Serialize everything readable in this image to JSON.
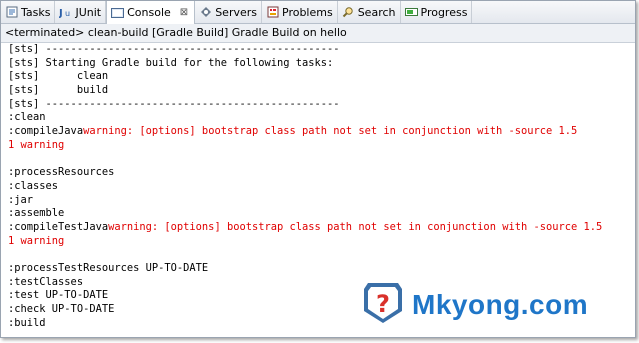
{
  "tabs": [
    {
      "label": "Tasks",
      "icon": "tasks-icon"
    },
    {
      "label": "JUnit",
      "icon": "junit-icon"
    },
    {
      "label": "Console",
      "icon": "console-icon",
      "active": true
    },
    {
      "label": "Servers",
      "icon": "servers-icon"
    },
    {
      "label": "Problems",
      "icon": "problems-icon"
    },
    {
      "label": "Search",
      "icon": "search-icon"
    },
    {
      "label": "Progress",
      "icon": "progress-icon"
    }
  ],
  "console_close": "⊠",
  "status_line": "<terminated> clean-build [Gradle Build] Gradle Build on hello",
  "console_lines": [
    {
      "text": "[sts] -----------------------------------------------"
    },
    {
      "text": "[sts] Starting Gradle build for the following tasks:"
    },
    {
      "text": "[sts]      clean"
    },
    {
      "text": "[sts]      build"
    },
    {
      "text": "[sts] -----------------------------------------------"
    },
    {
      "text": ":clean"
    },
    {
      "text": ":compileJava",
      "err": "warning: [options] bootstrap class path not set in conjunction with -source 1.5"
    },
    {
      "text": "",
      "err": "1 warning"
    },
    {
      "text": ""
    },
    {
      "text": ":processResources"
    },
    {
      "text": ":classes"
    },
    {
      "text": ":jar"
    },
    {
      "text": ":assemble"
    },
    {
      "text": ":compileTestJava",
      "err": "warning: [options] bootstrap class path not set in conjunction with -source 1.5"
    },
    {
      "text": "",
      "err": "1 warning"
    },
    {
      "text": ""
    },
    {
      "text": ":processTestResources UP-TO-DATE"
    },
    {
      "text": ":testClasses"
    },
    {
      "text": ":test UP-TO-DATE"
    },
    {
      "text": ":check UP-TO-DATE"
    },
    {
      "text": ":build"
    }
  ],
  "watermark": {
    "text": "Mkyong.com",
    "icon": "question-shield-logo"
  },
  "colors": {
    "error_text": "#e00000",
    "logo_blue": "#1f76c8",
    "logo_red": "#d9302a"
  }
}
